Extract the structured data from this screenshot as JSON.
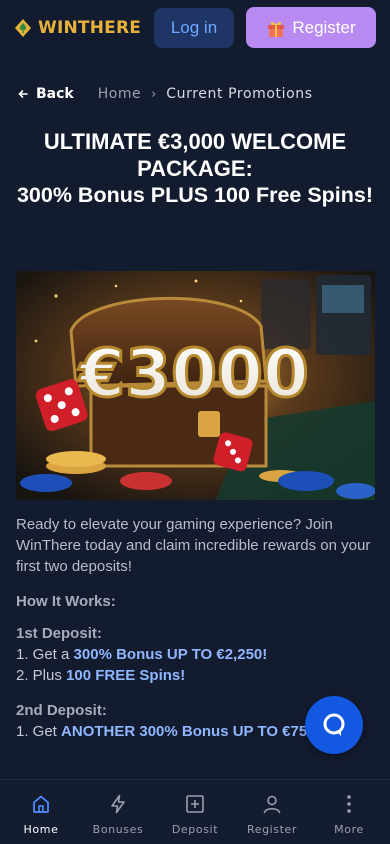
{
  "header": {
    "brand": "WINTHERE",
    "login_label": "Log in",
    "register_label": "Register"
  },
  "breadcrumb": {
    "back_label": "Back",
    "home_label": "Home",
    "current_label": "Current Promotions"
  },
  "page": {
    "title_line1": "ULTIMATE €3,000 WELCOME PACKAGE:",
    "title_line2": "300% Bonus PLUS 100 Free Spins!",
    "hero_text": "€3000"
  },
  "content": {
    "intro": "Ready to elevate your gaming experience? Join WinThere today and claim incredible rewards on your first two deposits!",
    "how_it_works": "How It Works:",
    "deposit1_heading": "1st Deposit:",
    "deposit1_line1_prefix": "1. Get a ",
    "deposit1_line1_highlight": "300% Bonus UP TO €2,250!",
    "deposit1_line2_prefix": "2. Plus ",
    "deposit1_line2_highlight": "100 FREE Spins!",
    "deposit2_heading": "2nd Deposit:",
    "deposit2_line1_prefix": "1. Get ",
    "deposit2_line1_highlight": "ANOTHER 300% Bonus UP TO €750!"
  },
  "bottom_nav": {
    "items": [
      {
        "label": "Home",
        "icon": "home-icon",
        "active": true
      },
      {
        "label": "Bonuses",
        "icon": "lightning-icon",
        "active": false
      },
      {
        "label": "Deposit",
        "icon": "plus-square-icon",
        "active": false
      },
      {
        "label": "Register",
        "icon": "user-icon",
        "active": false
      },
      {
        "label": "More",
        "icon": "more-vertical-icon",
        "active": false
      }
    ]
  },
  "colors": {
    "background": "#131b2e",
    "brand_gold": "#e8b23a",
    "login_bg": "#1e3566",
    "register_bg": "#b98af2",
    "highlight": "#8fb6ff",
    "active_nav": "#4f8bff",
    "chat_fab": "#1258e0"
  }
}
